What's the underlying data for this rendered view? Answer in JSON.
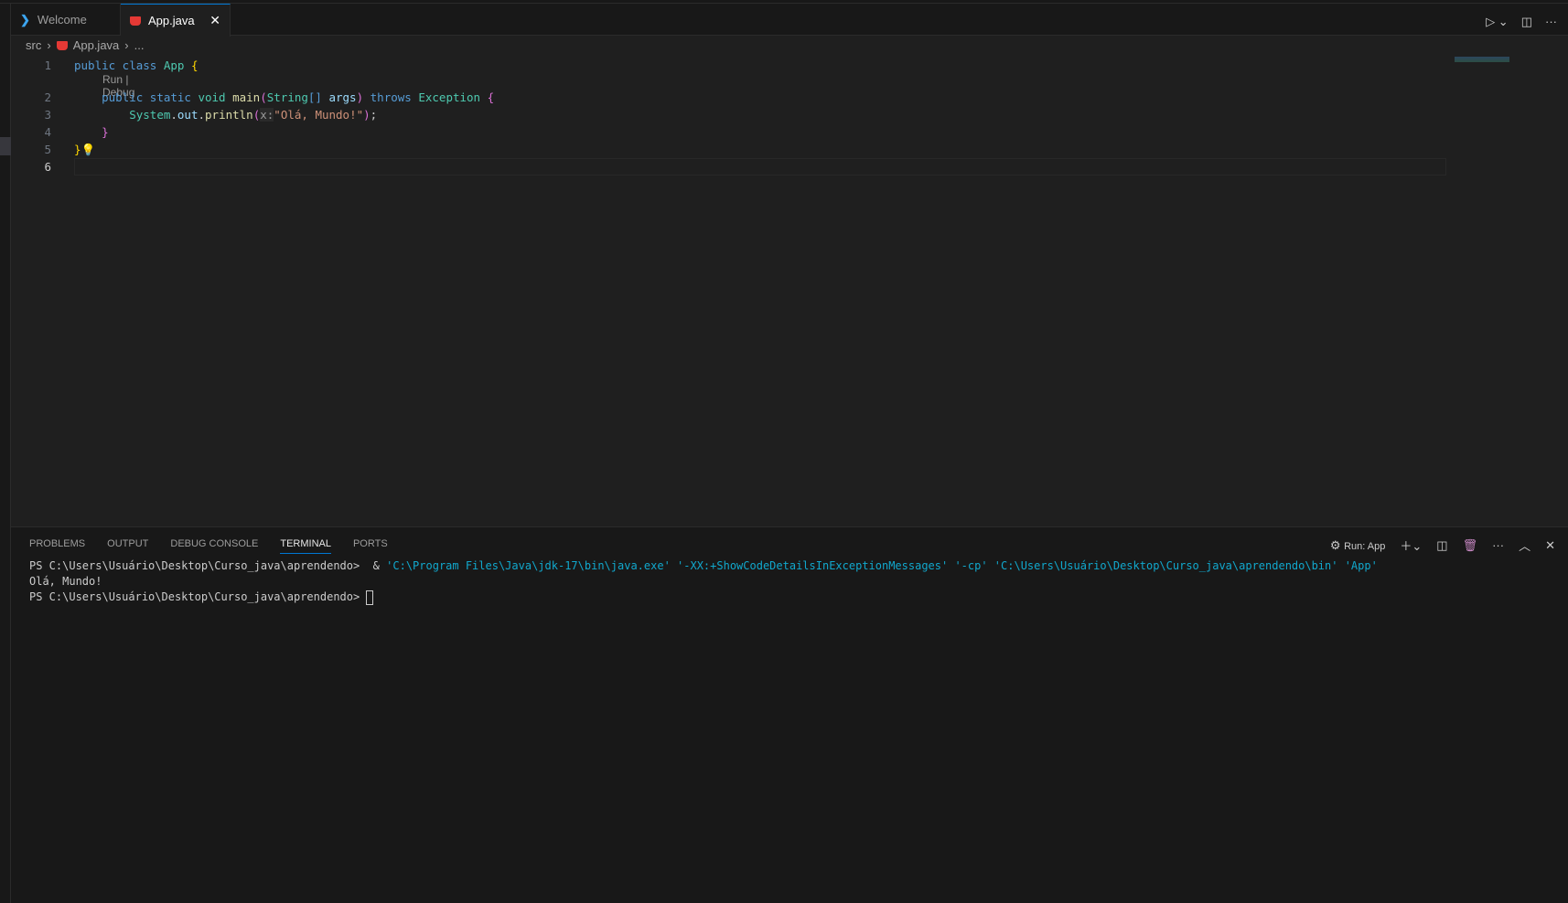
{
  "tabs": [
    {
      "label": "Welcome",
      "icon": "vscode-icon"
    },
    {
      "label": "App.java",
      "icon": "java-icon",
      "active": true
    }
  ],
  "breadcrumb": {
    "folder": "src",
    "file": "App.java",
    "more": "..."
  },
  "editor": {
    "lens": "Run | Debug",
    "line_numbers": [
      "1",
      "2",
      "3",
      "4",
      "5",
      "6"
    ]
  },
  "panel": {
    "tabs": [
      "PROBLEMS",
      "OUTPUT",
      "DEBUG CONSOLE",
      "TERMINAL",
      "PORTS"
    ],
    "active_tab": "TERMINAL",
    "run_label": "Run: App"
  },
  "terminal": {
    "prompt": "PS C:\\Users\\Usuário\\Desktop\\Curso_java\\aprendendo>",
    "command": "'C:\\Program Files\\Java\\jdk-17\\bin\\java.exe' '-XX:+ShowCodeDetailsInExceptionMessages' '-cp' 'C:\\Users\\Usuário\\Desktop\\Curso_java\\aprendendo\\bin' 'App'",
    "output": "Olá, Mundo!"
  },
  "colors": {
    "accent": "#0078d4",
    "background": "#1f1f1f"
  }
}
